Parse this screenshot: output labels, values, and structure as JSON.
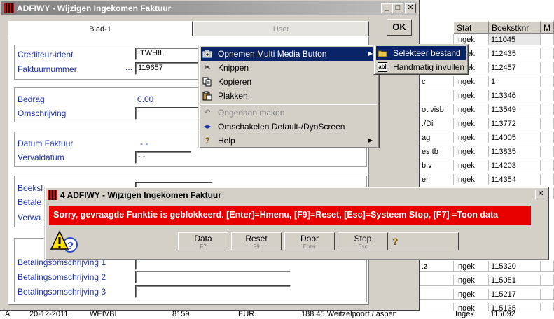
{
  "main_window": {
    "title": "ADFIWY - Wijzigen Ingekomen Faktuur",
    "minimize_glyph": "_",
    "maximize_glyph": "□",
    "close_glyph": "✕",
    "ok_label": "OK",
    "tabs": [
      "Blad-1",
      "User"
    ],
    "fields": {
      "crediteur_ident": {
        "label": "Crediteur-ident",
        "value": "ITWHIL"
      },
      "faktuurnummer": {
        "label": "Faktuurnummer",
        "prefix": "...",
        "value": "119657"
      },
      "bedrag": {
        "label": "Bedrag",
        "value": "0.00"
      },
      "omschrijving": {
        "label": "Omschrijving",
        "value": ""
      },
      "datum_faktuur": {
        "label": "Datum Faktuur",
        "value": "-  -"
      },
      "vervaldatum": {
        "label": "Vervaldatum",
        "value": "-  -"
      },
      "boeksl": {
        "label": "Boeksl",
        "value": ""
      },
      "betale": {
        "label": "Betale",
        "value": ""
      },
      "verwa": {
        "label": "Verwa",
        "value": ""
      },
      "betalingsomschrijving_1": {
        "label": "Betalingsomschrijving 1",
        "value": ""
      },
      "betalingsomschrijving_2": {
        "label": "Betalingsomschrijving 2",
        "value": ""
      },
      "betalingsomschrijving_3": {
        "label": "Betalingsomschrijving 3",
        "value": ""
      }
    }
  },
  "context_menu": {
    "items": [
      {
        "label": "Opnemen Multi Media Button",
        "icon": "camera-icon",
        "submenu": true,
        "selected": true
      },
      {
        "label": "Knippen",
        "icon": "scissors-icon"
      },
      {
        "label": "Kopieren",
        "icon": "copy-icon"
      },
      {
        "label": "Plakken",
        "icon": "paste-icon"
      },
      {
        "label": "Ongedaan maken",
        "icon": "undo-icon",
        "disabled": true
      },
      {
        "label": "Omschakelen Default-/DynScreen",
        "icon": "switch-icon"
      },
      {
        "label": "Help",
        "icon": "help-icon",
        "submenu": true
      }
    ],
    "submenu": [
      {
        "label": "Selekteer bestand",
        "icon": "folder-icon",
        "selected": true
      },
      {
        "label": "Handmatig invullen",
        "icon": "abl-icon",
        "icon_text": "abl"
      }
    ]
  },
  "grid": {
    "headers": [
      "Stat",
      "Boekstknr",
      "M"
    ],
    "rows": [
      {
        "left": "",
        "stat": "Ingek",
        "boekstknr": "111045"
      },
      {
        "left": "",
        "stat": "Ingek",
        "boekstknr": "112435"
      },
      {
        "left": "",
        "stat": "Ingek",
        "boekstknr": "112457"
      },
      {
        "left": "c",
        "stat": "Ingek",
        "boekstknr": "1"
      },
      {
        "left": "",
        "stat": "Ingek",
        "boekstknr": "113346"
      },
      {
        "left": "ot visb",
        "stat": "Ingek",
        "boekstknr": "113549"
      },
      {
        "left": "./Di",
        "stat": "Ingek",
        "boekstknr": "113772"
      },
      {
        "left": "ag",
        "stat": "Ingek",
        "boekstknr": "114005"
      },
      {
        "left": "es tb",
        "stat": "Ingek",
        "boekstknr": "113835"
      },
      {
        "left": "b.v",
        "stat": "Ingek",
        "boekstknr": "114203"
      },
      {
        "left": "er",
        "stat": "Ingek",
        "boekstknr": "114354"
      },
      {
        "left": "",
        "stat": "Ingek",
        "boekstknr": "114691"
      }
    ],
    "rows_lower": [
      {
        "left": ".z",
        "stat": "Ingek",
        "boekstknr": "115320"
      },
      {
        "left": "",
        "stat": "Ingek",
        "boekstknr": "115051"
      },
      {
        "left": "",
        "stat": "Ingek",
        "boekstknr": "115217"
      },
      {
        "left": "",
        "stat": "Ingek",
        "boekstknr": "115135"
      }
    ],
    "bottom_row": [
      "IA",
      "20-12-2011",
      "WEIVBI",
      "8159",
      "EUR",
      "188.45 Weitzelpoort / aspen",
      "Ingek",
      "115092"
    ]
  },
  "error_dialog": {
    "title": "4 ADFIWY - Wijzigen Ingekomen Faktuur",
    "close_glyph": "✕",
    "message": "Sorry, gevraagde Funktie is geblokkeerd.  [Enter]=Hmenu, [F9]=Reset, [Esc]=Systeem Stop, [F7] =Toon data",
    "buttons": [
      {
        "label": "Data",
        "key": "F7"
      },
      {
        "label": "Reset",
        "key": "F9"
      },
      {
        "label": "Door",
        "key": "Enter"
      },
      {
        "label": "Stop",
        "key": "Esc"
      },
      {
        "label": "",
        "icon": "help-icon"
      }
    ]
  },
  "colors": {
    "message_bg": "#e80000",
    "menu_highlight": "#0a246a",
    "label_blue": "#1f33a8"
  }
}
